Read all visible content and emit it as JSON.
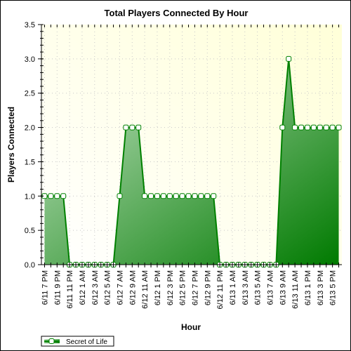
{
  "chart_data": {
    "type": "area",
    "title": "Total Players Connected By Hour",
    "xlabel": "Hour",
    "ylabel": "Players Connected",
    "ylim": [
      0,
      3.5
    ],
    "yticks": [
      "0.0",
      "0.5",
      "1.0",
      "1.5",
      "2.0",
      "2.5",
      "3.0",
      "3.5"
    ],
    "grid": true,
    "legend_placement": "bottom-left",
    "colors": {
      "line": "#008000",
      "fill_light": "#b4dab4",
      "fill_dark": "#007a00",
      "bg_light": "#ffffd8",
      "marker_fill": "#ffffff"
    },
    "x": [
      "6/11 7 PM",
      "6/11 8 PM",
      "6/11 9 PM",
      "6/11 10 PM",
      "6/11 11 PM",
      "6/12 12 AM",
      "6/12 1 AM",
      "6/12 2 AM",
      "6/12 3 AM",
      "6/12 4 AM",
      "6/12 5 AM",
      "6/12 6 AM",
      "6/12 7 AM",
      "6/12 8 AM",
      "6/12 9 AM",
      "6/12 10 AM",
      "6/12 11 AM",
      "6/12 12 PM",
      "6/12 1 PM",
      "6/12 2 PM",
      "6/12 3 PM",
      "6/12 4 PM",
      "6/12 5 PM",
      "6/12 6 PM",
      "6/12 7 PM",
      "6/12 8 PM",
      "6/12 9 PM",
      "6/12 10 PM",
      "6/12 11 PM",
      "6/13 12 AM",
      "6/13 1 AM",
      "6/13 2 AM",
      "6/13 3 AM",
      "6/13 4 AM",
      "6/13 5 AM",
      "6/13 6 AM",
      "6/13 7 AM",
      "6/13 8 AM",
      "6/13 9 AM",
      "6/13 10 AM",
      "6/13 11 AM",
      "6/13 12 PM",
      "6/13 1 PM",
      "6/13 2 PM",
      "6/13 3 PM",
      "6/13 4 PM",
      "6/13 5 PM",
      "6/13 6 PM"
    ],
    "xtick_labels": [
      "6/11 7 PM",
      "6/11 9 PM",
      "6/11 11 PM",
      "6/12 1 AM",
      "6/12 3 AM",
      "6/12 5 AM",
      "6/12 7 AM",
      "6/12 9 AM",
      "6/12 11 AM",
      "6/12 1 PM",
      "6/12 3 PM",
      "6/12 5 PM",
      "6/12 7 PM",
      "6/12 9 PM",
      "6/12 11 PM",
      "6/13 1 AM",
      "6/13 3 AM",
      "6/13 5 AM",
      "6/13 7 AM",
      "6/13 9 AM",
      "6/13 11 AM",
      "6/13 1 PM",
      "6/13 3 PM",
      "6/13 5 PM"
    ],
    "series": [
      {
        "name": "Secret of Life",
        "values": [
          1,
          1,
          1,
          1,
          0,
          0,
          0,
          0,
          0,
          0,
          0,
          0,
          1,
          2,
          2,
          2,
          1,
          1,
          1,
          1,
          1,
          1,
          1,
          1,
          1,
          1,
          1,
          1,
          0,
          0,
          0,
          0,
          0,
          0,
          0,
          0,
          0,
          0,
          2,
          3,
          2,
          2,
          2,
          2,
          2,
          2,
          2,
          2
        ]
      }
    ]
  }
}
